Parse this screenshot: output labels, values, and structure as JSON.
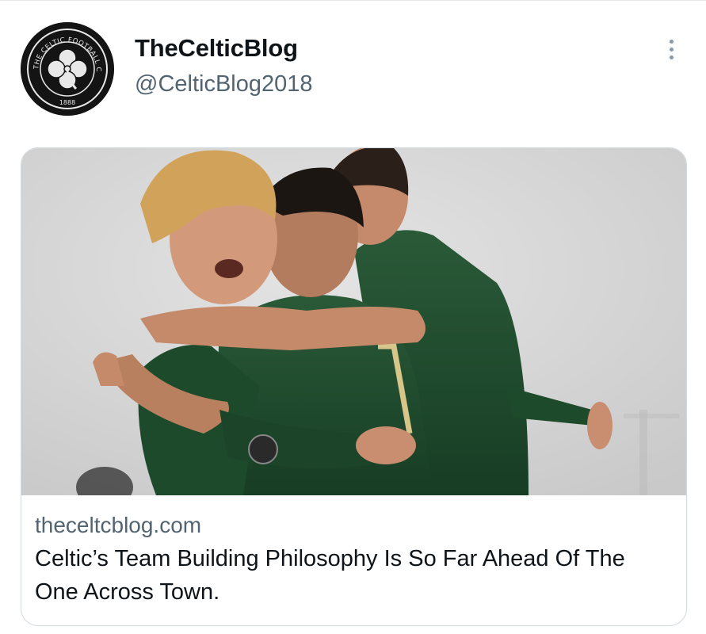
{
  "tweet": {
    "author": {
      "display_name": "TheCelticBlog",
      "handle": "@CelticBlog2018",
      "avatar": {
        "icon": "celtic-crest-icon",
        "ring_text": "THE CELTIC FOOTBALL CLUB",
        "year": "1888"
      }
    },
    "menu_icon": "more-options-icon",
    "card": {
      "image_alt": "Celtic players in green kits embracing in celebration",
      "domain": "theceltcblog.com",
      "title": "Celtic’s Team Building Philosophy Is So Far Ahead Of The One Across Town."
    }
  },
  "colors": {
    "text_primary": "#0f1419",
    "text_secondary": "#536471",
    "border": "#cfd9de",
    "kit_green": "#1f4a2e"
  }
}
